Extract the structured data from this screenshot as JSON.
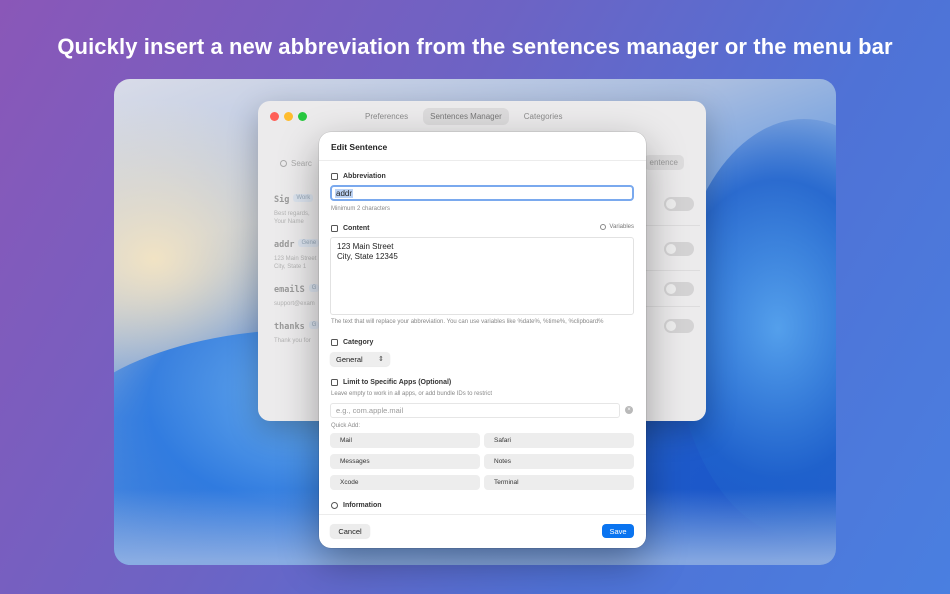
{
  "headline": "Quickly insert a new abbreviation from the sentences manager or the menu bar",
  "background_window": {
    "tabs": [
      {
        "label": "Preferences"
      },
      {
        "label": "Sentences Manager"
      },
      {
        "label": "Categories"
      }
    ],
    "search_placeholder": "Searc",
    "new_button_label": "entence",
    "rows": [
      {
        "abbr": "Sig",
        "badge": "Work",
        "desc1": "Best regards,",
        "desc2": "Your Name"
      },
      {
        "abbr": "addr",
        "badge": "Gene",
        "desc1": "123 Main Street",
        "desc2": "City, State 1"
      },
      {
        "abbr": "emailS",
        "badge": "G",
        "desc1": "support@exam",
        "desc2": ""
      },
      {
        "abbr": "thanks",
        "badge": "G",
        "desc1": "Thank you for",
        "desc2": ""
      }
    ]
  },
  "dialog": {
    "title": "Edit Sentence",
    "abbreviation": {
      "label": "Abbreviation",
      "value": "addr",
      "hint": "Minimum 2 characters"
    },
    "content": {
      "label": "Content",
      "variables_label": "Variables",
      "line1": "123 Main Street",
      "line2": "City, State 12345",
      "hint": "The text that will replace your abbreviation. You can use variables like %date%, %time%, %clipboard%"
    },
    "category": {
      "label": "Category",
      "selected": "General"
    },
    "apps": {
      "label": "Limit to Specific Apps (Optional)",
      "hint": "Leave empty to work in all apps, or add bundle IDs to restrict",
      "placeholder": "e.g., com.apple.mail",
      "quick_add_label": "Quick Add:",
      "quick_add": [
        "Mail",
        "Safari",
        "Messages",
        "Notes",
        "Xcode",
        "Terminal"
      ]
    },
    "information_label": "Information",
    "cancel_label": "Cancel",
    "save_label": "Save"
  },
  "colors": {
    "accent": "#0a74f0",
    "traffic_red": "#ff5f57",
    "traffic_yellow": "#febc2e",
    "traffic_green": "#28c840"
  }
}
